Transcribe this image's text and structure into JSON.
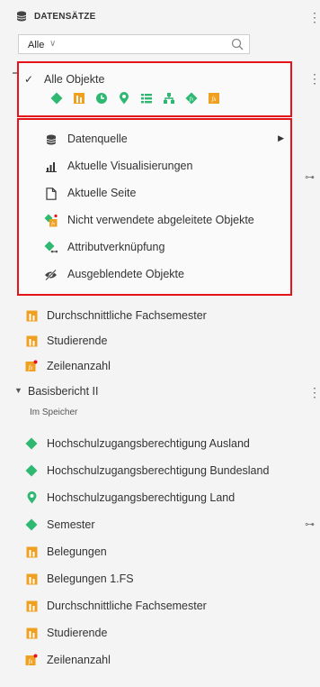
{
  "header": {
    "title": "DATENSÄTZE",
    "icon": "database-icon",
    "menu_glyph": "⋮"
  },
  "search": {
    "value": "Alle",
    "chevron": "∨"
  },
  "menu": {
    "all_objects": {
      "label": "Alle Objekte",
      "checked": true,
      "check_glyph": "✓"
    },
    "filter_icons": [
      "dimension-icon",
      "measure-icon",
      "time-icon",
      "geo-icon",
      "list-icon",
      "hierarchy-icon",
      "calculated-dimension-icon",
      "calculated-measure-icon"
    ],
    "items": [
      {
        "label": "Datenquelle",
        "icon": "database-icon",
        "submenu": "▶"
      },
      {
        "label": "Aktuelle Visualisierungen",
        "icon": "bar-chart-icon"
      },
      {
        "label": "Aktuelle Seite",
        "icon": "page-icon"
      },
      {
        "label": "Nicht verwendete abgeleitete Objekte",
        "icon": "unused-derived-icon"
      },
      {
        "label": "Attributverknüpfung",
        "icon": "attribute-link-icon"
      },
      {
        "label": "Ausgeblendete Objekte",
        "icon": "hidden-eye-icon"
      }
    ]
  },
  "dataset1_items": [
    {
      "label": "Durchschnittliche Fachsemester",
      "type": "measure"
    },
    {
      "label": "Studierende",
      "type": "measure"
    },
    {
      "label": "Zeilenanzahl",
      "type": "calculated"
    }
  ],
  "dataset2": {
    "title": "Basisbericht II",
    "subtitle": "Im Speicher",
    "expand_glyph": "▼",
    "items": [
      {
        "label": "Hochschulzugangsberechtigung Ausland",
        "type": "dimension"
      },
      {
        "label": "Hochschulzugangsberechtigung Bundesland",
        "type": "dimension"
      },
      {
        "label": "Hochschulzugangsberechtigung Land",
        "type": "geo"
      },
      {
        "label": "Semester",
        "type": "dimension"
      },
      {
        "label": "Belegungen",
        "type": "measure"
      },
      {
        "label": "Belegungen 1.FS",
        "type": "measure"
      },
      {
        "label": "Durchschnittliche Fachsemester",
        "type": "measure"
      },
      {
        "label": "Studierende",
        "type": "measure"
      },
      {
        "label": "Zeilenanzahl",
        "type": "calculated"
      }
    ]
  },
  "colors": {
    "green": "#2eb872",
    "orange": "#f0a020",
    "red_outline": "#e5141b"
  }
}
